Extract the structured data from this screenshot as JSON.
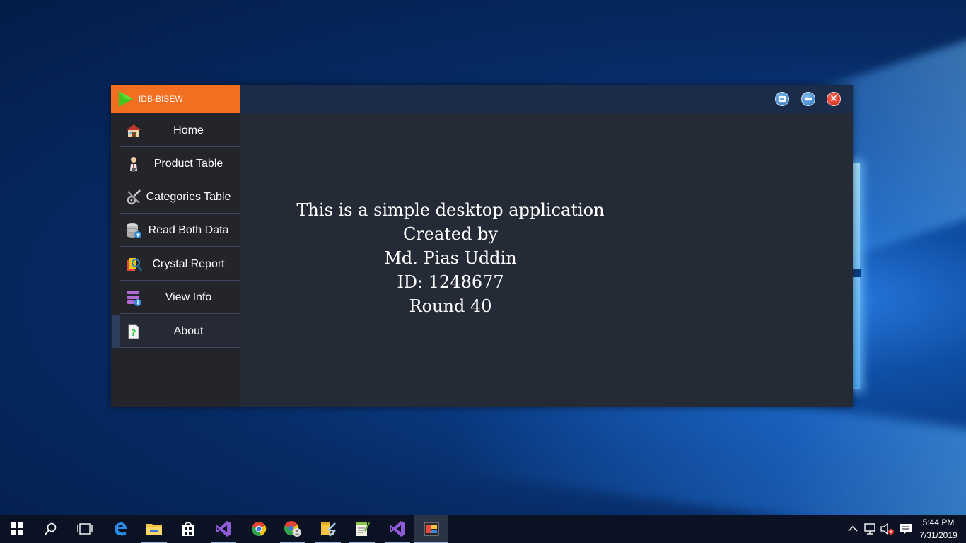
{
  "app": {
    "title": "IDB-BISEW",
    "accent_color": "#f26f21",
    "window_buttons": [
      {
        "name": "restore",
        "icon": "restore-icon"
      },
      {
        "name": "minimize",
        "icon": "minimize-icon"
      },
      {
        "name": "close",
        "icon": "close-icon"
      }
    ]
  },
  "sidebar": {
    "items": [
      {
        "label": "Home",
        "icon": "house-icon"
      },
      {
        "label": "Product Table",
        "icon": "person-icon"
      },
      {
        "label": "Categories Table",
        "icon": "tools-icon"
      },
      {
        "label": "Read Both Data",
        "icon": "database-icon"
      },
      {
        "label": "Crystal Report",
        "icon": "report-icon"
      },
      {
        "label": "View Info",
        "icon": "info-stack-icon"
      },
      {
        "label": "About",
        "icon": "help-document-icon"
      }
    ],
    "active_item": "About"
  },
  "main": {
    "lines": [
      "This is a simple desktop application",
      "Created by",
      "Md. Pias Uddin",
      "ID: 1248677",
      "Round 40"
    ]
  },
  "taskbar": {
    "apps": [
      "start-icon",
      "search-icon",
      "task-view-icon",
      "edge-icon",
      "file-explorer-icon",
      "store-icon",
      "visual-studio-icon",
      "chrome-icon",
      "chrome-profile-icon",
      "sql-tools-icon",
      "notepad-plus-icon",
      "visual-studio-2-icon",
      "app-running-icon"
    ],
    "clock": {
      "time": "5:44 PM",
      "date": "7/31/2019"
    }
  }
}
